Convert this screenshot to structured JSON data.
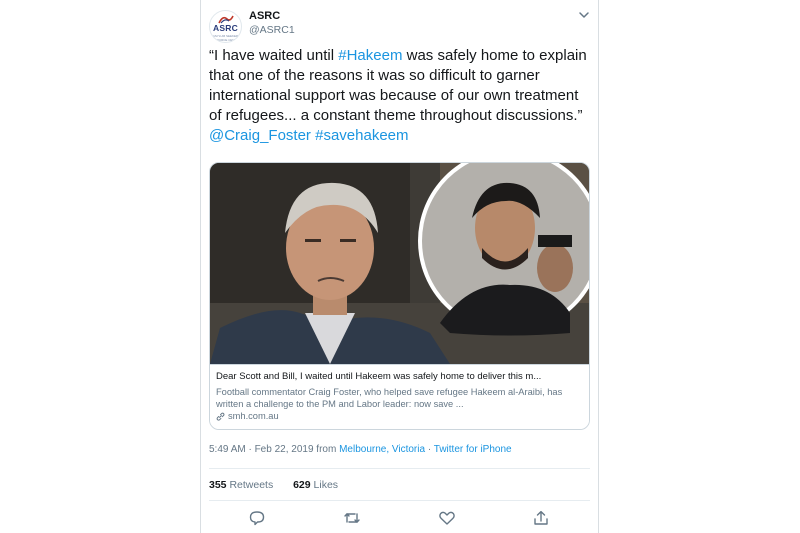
{
  "author": {
    "name": "ASRC",
    "handle": "@ASRC1",
    "avatar_text": "ASRC",
    "avatar_subtext": "ASYLUM SEEKER RESOURCE CENTRE"
  },
  "tweet": {
    "text_1": "“I have waited until ",
    "hashtag_1": "#Hakeem",
    "text_2": " was safely home to explain that one of the reasons it was so difficult to garner international support was because of our own treatment of refugees... a constant theme throughout discussions.” ",
    "mention": "@Craig_Foster",
    "text_3": " ",
    "hashtag_2": "#savehakeem"
  },
  "link_card": {
    "title": "Dear Scott and Bill, I waited until Hakeem was safely home to deliver this m...",
    "description": "Football commentator Craig Foster, who helped save refugee Hakeem al-Araibi, has written a challenge to the PM and Labor leader: now save ...",
    "domain": "smh.com.au"
  },
  "meta": {
    "time_date": "5:49 AM · Feb 22, 2019 from ",
    "location": "Melbourne, Victoria",
    "separator": " · ",
    "source": "Twitter for iPhone"
  },
  "stats": {
    "retweets_count": "355",
    "retweets_label": "Retweets",
    "likes_count": "629",
    "likes_label": "Likes"
  },
  "icons": {
    "caret": "chevron-down-icon",
    "reply": "reply-icon",
    "retweet": "retweet-icon",
    "like": "heart-icon",
    "share": "share-icon",
    "link": "link-icon"
  },
  "colors": {
    "accent": "#1b95e0",
    "text": "#14171a",
    "secondary": "#657786",
    "border": "#ccd6dd"
  }
}
